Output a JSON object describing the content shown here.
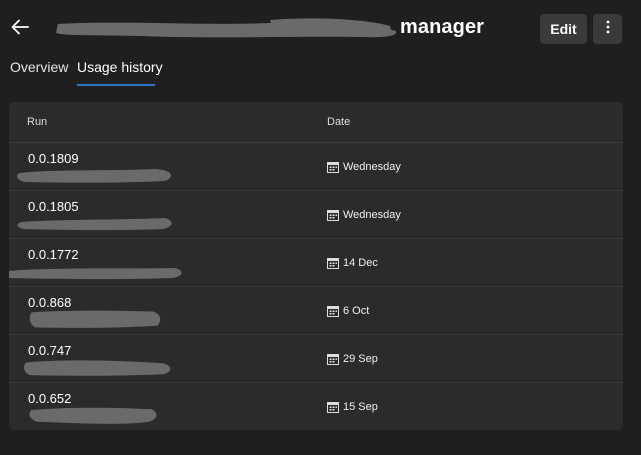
{
  "header": {
    "title": "manager",
    "edit_label": "Edit",
    "icons": {
      "back": "back-arrow-icon",
      "more": "more-vertical-icon"
    }
  },
  "tabs": [
    {
      "label": "Overview",
      "active": false
    },
    {
      "label": "Usage history",
      "active": true
    }
  ],
  "table": {
    "columns": [
      "Run",
      "Date"
    ],
    "rows": [
      {
        "run": "0.0.1809",
        "date": "Wednesday"
      },
      {
        "run": "0.0.1805",
        "date": "Wednesday"
      },
      {
        "run": "0.0.1772",
        "date": "14 Dec"
      },
      {
        "run": "0.0.868",
        "date": "6 Oct"
      },
      {
        "run": "0.0.747",
        "date": "29 Sep"
      },
      {
        "run": "0.0.652",
        "date": "15 Sep"
      }
    ]
  },
  "colors": {
    "background": "#1f1f1f",
    "card": "#2b2b2b",
    "accent": "#2f74c0",
    "button": "#3a3a3a",
    "redaction": "#6a6a6a"
  }
}
